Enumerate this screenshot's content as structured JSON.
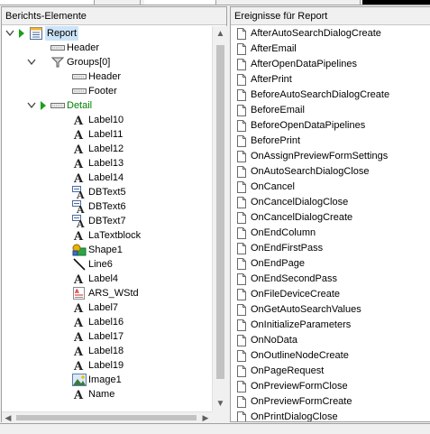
{
  "left_panel": {
    "title": "Berichts-Elemente"
  },
  "right_panel": {
    "title": "Ereignisse für Report"
  },
  "tree": [
    {
      "label": "Report",
      "level": 0,
      "icon": "report-icon",
      "expander": "expanded",
      "arrow": true,
      "selected": true
    },
    {
      "label": "Header",
      "level": 1,
      "icon": "band-icon"
    },
    {
      "label": "Groups[0]",
      "level": 1,
      "icon": "groups-icon",
      "expander": "expanded"
    },
    {
      "label": "Header",
      "level": 2,
      "icon": "band-icon"
    },
    {
      "label": "Footer",
      "level": 2,
      "icon": "band-icon"
    },
    {
      "label": "Detail",
      "level": 1,
      "icon": "band-icon",
      "expander": "expanded",
      "arrow": true,
      "green": true
    },
    {
      "label": "Label10",
      "level": 2,
      "icon": "label-icon"
    },
    {
      "label": "Label11",
      "level": 2,
      "icon": "label-icon"
    },
    {
      "label": "Label12",
      "level": 2,
      "icon": "label-icon"
    },
    {
      "label": "Label13",
      "level": 2,
      "icon": "label-icon"
    },
    {
      "label": "Label14",
      "level": 2,
      "icon": "label-icon"
    },
    {
      "label": "DBText5",
      "level": 2,
      "icon": "dbtext-icon"
    },
    {
      "label": "DBText6",
      "level": 2,
      "icon": "dbtext-icon"
    },
    {
      "label": "DBText7",
      "level": 2,
      "icon": "dbtext-icon"
    },
    {
      "label": "LaTextblock",
      "level": 2,
      "icon": "label-icon"
    },
    {
      "label": "Shape1",
      "level": 2,
      "icon": "shape-icon"
    },
    {
      "label": "Line6",
      "level": 2,
      "icon": "line-icon"
    },
    {
      "label": "Label4",
      "level": 2,
      "icon": "label-icon"
    },
    {
      "label": "ARS_WStd",
      "level": 2,
      "icon": "richtext-icon"
    },
    {
      "label": "Label7",
      "level": 2,
      "icon": "label-icon"
    },
    {
      "label": "Label16",
      "level": 2,
      "icon": "label-icon"
    },
    {
      "label": "Label17",
      "level": 2,
      "icon": "label-icon"
    },
    {
      "label": "Label18",
      "level": 2,
      "icon": "label-icon"
    },
    {
      "label": "Label19",
      "level": 2,
      "icon": "label-icon"
    },
    {
      "label": "Image1",
      "level": 2,
      "icon": "image-icon"
    },
    {
      "label": "Name",
      "level": 2,
      "icon": "label-icon"
    }
  ],
  "events": [
    "AfterAutoSearchDialogCreate",
    "AfterEmail",
    "AfterOpenDataPipelines",
    "AfterPrint",
    "BeforeAutoSearchDialogCreate",
    "BeforeEmail",
    "BeforeOpenDataPipelines",
    "BeforePrint",
    "OnAssignPreviewFormSettings",
    "OnAutoSearchDialogClose",
    "OnCancel",
    "OnCancelDialogClose",
    "OnCancelDialogCreate",
    "OnEndColumn",
    "OnEndFirstPass",
    "OnEndPage",
    "OnEndSecondPass",
    "OnFileDeviceCreate",
    "OnGetAutoSearchValues",
    "OnInitializeParameters",
    "OnNoData",
    "OnOutlineNodeCreate",
    "OnPageRequest",
    "OnPreviewFormClose",
    "OnPreviewFormCreate",
    "OnPrintDialogClose"
  ],
  "scroll": {
    "up": "▲",
    "down": "▼",
    "left": "◀",
    "right": "▶"
  }
}
